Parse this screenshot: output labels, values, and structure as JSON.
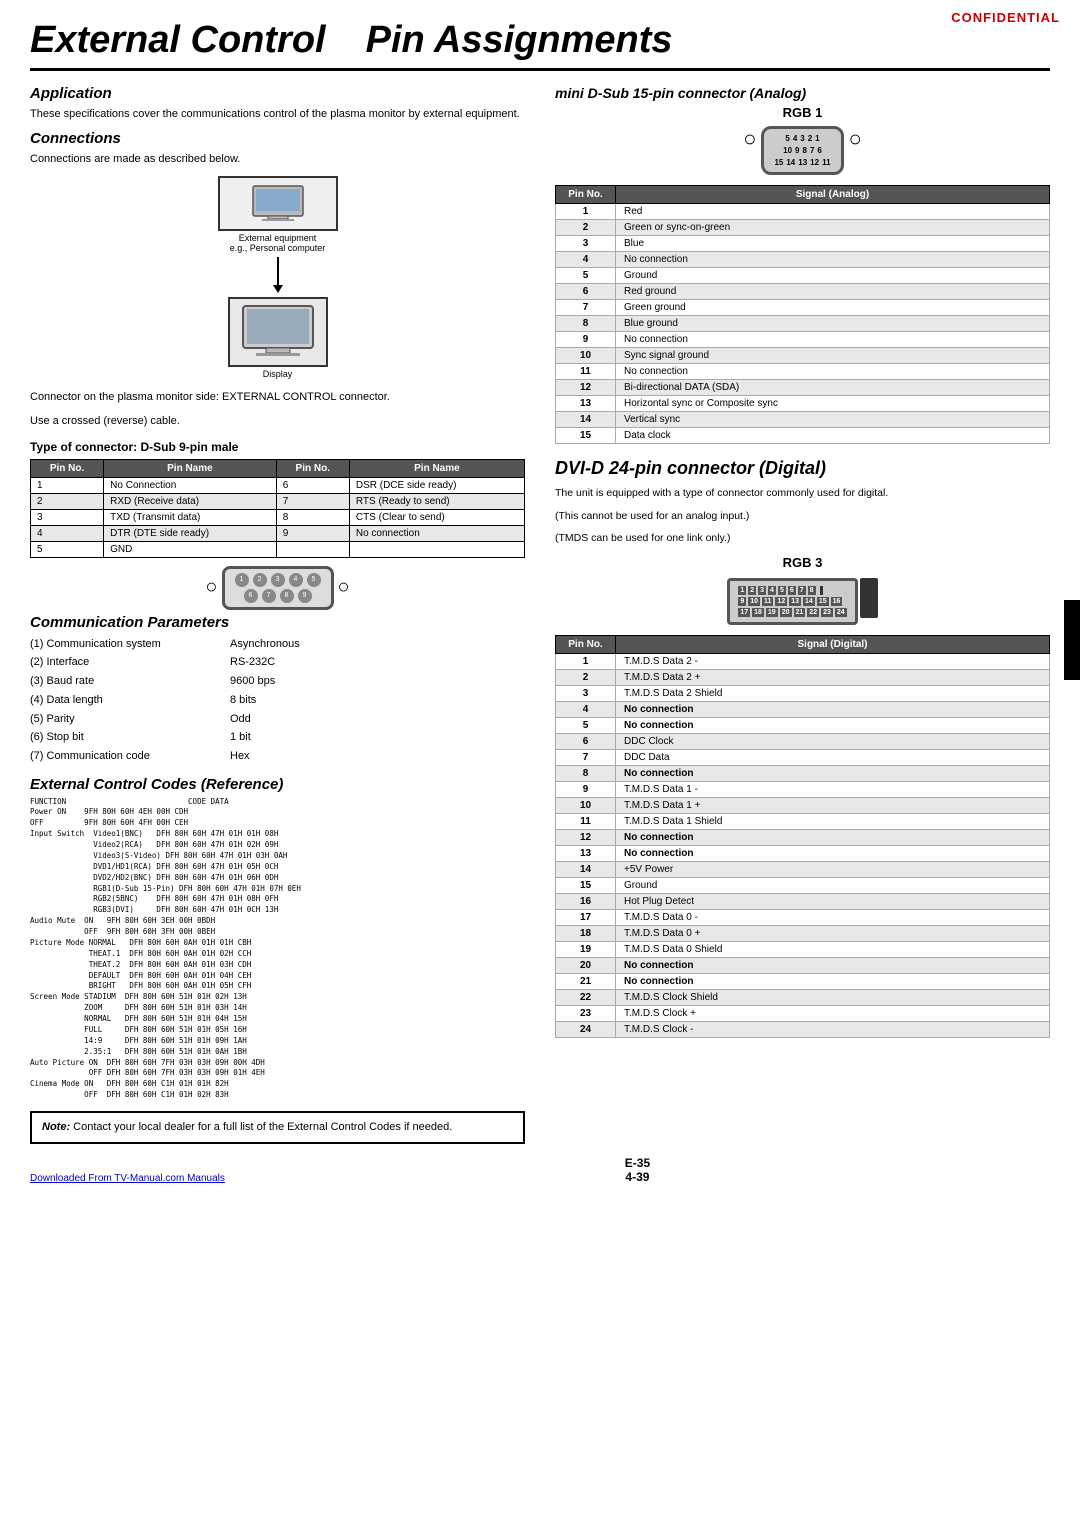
{
  "confidential": "CONFIDENTIAL",
  "title": {
    "part1": "External Control",
    "part2": "Pin Assignments"
  },
  "application": {
    "title": "Application",
    "text": "These specifications cover the communications control of the plasma monitor by external equipment."
  },
  "connections": {
    "title": "Connections",
    "text": "Connections are made as described below.",
    "external_label": "External equipment",
    "external_sub": "e.g., Personal computer",
    "display_label": "Display",
    "connector_text1": "Connector on the plasma monitor side: EXTERNAL CONTROL connector.",
    "connector_text2": "Use a crossed (reverse) cable."
  },
  "type_connector": {
    "title": "Type of connector: D-Sub 9-pin male",
    "headers": [
      "Pin No.",
      "Pin Name",
      "Pin No.",
      "Pin Name"
    ],
    "rows": [
      [
        "1",
        "No Connection",
        "6",
        "DSR (DCE side ready)"
      ],
      [
        "2",
        "RXD (Receive data)",
        "7",
        "RTS (Ready to send)"
      ],
      [
        "3",
        "TXD (Transmit data)",
        "8",
        "CTS (Clear to send)"
      ],
      [
        "4",
        "DTR (DTE side ready)",
        "9",
        "No connection"
      ],
      [
        "5",
        "GND",
        "",
        ""
      ]
    ]
  },
  "comm_params": {
    "title": "Communication Parameters",
    "items": [
      [
        "(1) Communication system",
        "Asynchronous"
      ],
      [
        "(2) Interface",
        "RS-232C"
      ],
      [
        "(3) Baud rate",
        "9600 bps"
      ],
      [
        "(4) Data length",
        "8 bits"
      ],
      [
        "(5) Parity",
        "Odd"
      ],
      [
        "(6) Stop bit",
        "1 bit"
      ],
      [
        "(7) Communication code",
        "Hex"
      ]
    ]
  },
  "ext_control_codes": {
    "title": "External Control Codes (Reference)",
    "sections": [
      {
        "fn": "FUNCTION",
        "sub": "",
        "label": "Power ON",
        "codes": "9FH 80H 60H 4EH 00H CDH"
      },
      {
        "fn": "",
        "sub": "",
        "label": "OFF",
        "codes": "9FH 80H 60H 4FH 00H CEH"
      }
    ],
    "raw_text": [
      "FUNCTION                           CODE DATA",
      "Power ON    9FH 80H 60H 4EH 00H CDH",
      "OFF         9FH 80H 60H 4FH 00H CEH",
      "",
      "Input Switch  Video1(BNC)   DFH 80H 60H 47H 01H 01H 08H",
      "              Video2(RCA)   DFH 80H 60H 47H 01H 02H 09H",
      "              Video3(S-Video) DFH 80H 60H 47H 01H 03H 0AH",
      "              DVD1/HD1(RCA) DFH 80H 60H 47H 01H 05H 0CH",
      "              DVD2/HD2(BNC) DFH 80H 60H 47H 01H 06H 0DH",
      "              RGB1(D-Sub 15-Pin) DFH 80H 60H 47H 01H 07H 0EH",
      "              RGB2(5BNC)    DFH 80H 60H 47H 01H 08H 0FH",
      "              RGB3(DVI)     DFH 80H 60H 47H 01H 0CH 13H",
      "",
      "Audio Mute  ON   9FH 80H 60H 3EH 00H 0BDH",
      "            OFF  9FH 80H 60H 3FH 00H 0BEH",
      "",
      "Picture Mode NORMAL   DFH 80H 60H 0AH 01H 01H CBH",
      "             THEAT.1  DFH 80H 60H 0AH 01H 02H CCH",
      "             THEAT.2  DFH 80H 60H 0AH 01H 03H CDH",
      "             DEFAULT  DFH 80H 60H 0AH 01H 04H CEH",
      "             BRIGHT   DFH 80H 60H 0AH 01H 05H CFH",
      "",
      "Screen Mode STADIUM  DFH 80H 60H 51H 01H 02H 13H",
      "            ZOOM     DFH 80H 60H 51H 01H 03H 14H",
      "            NORMAL   DFH 80H 60H 51H 01H 04H 15H",
      "            FULL     DFH 80H 60H 51H 01H 05H 16H",
      "            14:9     DFH 80H 60H 51H 01H 09H 1AH",
      "            2.35:1   DFH 80H 60H 51H 01H 0AH 1BH",
      "",
      "Auto Picture ON  DFH 80H 60H 7FH 03H 03H 09H 00H 4DH",
      "             OFF DFH 80H 60H 7FH 03H 03H 09H 01H 4EH",
      "",
      "Cinema Mode ON   DFH 80H 60H C1H 01H 01H 82H",
      "            OFF  DFH 80H 60H C1H 01H 02H 83H"
    ]
  },
  "mini_dsub": {
    "title": "mini D-Sub 15-pin connector (Analog)",
    "rgb_label": "RGB 1",
    "pin_table_headers": [
      "Pin No.",
      "Signal (Analog)"
    ],
    "pin_rows": [
      [
        "1",
        "Red"
      ],
      [
        "2",
        "Green or sync-on-green"
      ],
      [
        "3",
        "Blue"
      ],
      [
        "4",
        "No connection"
      ],
      [
        "5",
        "Ground"
      ],
      [
        "6",
        "Red ground"
      ],
      [
        "7",
        "Green ground"
      ],
      [
        "8",
        "Blue ground"
      ],
      [
        "9",
        "No connection"
      ],
      [
        "10",
        "Sync signal ground"
      ],
      [
        "11",
        "No connection"
      ],
      [
        "12",
        "Bi-directional DATA (SDA)"
      ],
      [
        "13",
        "Horizontal sync or Composite sync"
      ],
      [
        "14",
        "Vertical sync"
      ],
      [
        "15",
        "Data clock"
      ]
    ]
  },
  "dvi": {
    "title": "DVI-D 24-pin connector (Digital)",
    "text1": "The unit is equipped with a type of connector commonly used for digital.",
    "text2": "(This cannot be used for an analog input.)",
    "text3": "(TMDS can be used for one link only.)",
    "rgb_label": "RGB 3",
    "pin_table_headers": [
      "Pin No.",
      "Signal (Digital)"
    ],
    "pin_rows": [
      [
        "1",
        "T.M.D.S Data 2 -"
      ],
      [
        "2",
        "T.M.D.S Data 2 +"
      ],
      [
        "3",
        "T.M.D.S Data 2 Shield"
      ],
      [
        "4",
        "No connection"
      ],
      [
        "5",
        "No connection"
      ],
      [
        "6",
        "DDC Clock"
      ],
      [
        "7",
        "DDC Data"
      ],
      [
        "8",
        "No connection"
      ],
      [
        "9",
        "T.M.D.S Data 1 -"
      ],
      [
        "10",
        "T.M.D.S Data 1 +"
      ],
      [
        "11",
        "T.M.D.S Data 1 Shield"
      ],
      [
        "12",
        "No connection"
      ],
      [
        "13",
        "No connection"
      ],
      [
        "14",
        "+5V Power"
      ],
      [
        "15",
        "Ground"
      ],
      [
        "16",
        "Hot Plug Detect"
      ],
      [
        "17",
        "T.M.D.S Data 0 -"
      ],
      [
        "18",
        "T.M.D.S Data 0 +"
      ],
      [
        "19",
        "T.M.D.S Data 0 Shield"
      ],
      [
        "20",
        "No connection"
      ],
      [
        "21",
        "No connection"
      ],
      [
        "22",
        "T.M.D.S Clock Shield"
      ],
      [
        "23",
        "T.M.D.S Clock +"
      ],
      [
        "24",
        "T.M.D.S Clock -"
      ]
    ]
  },
  "note": {
    "label": "Note:",
    "text": "Contact your local dealer for a full list of the External Control Codes if needed."
  },
  "footer": {
    "download_text": "Downloaded From TV-Manual.com Manuals",
    "page1": "E-35",
    "page2": "4-39"
  }
}
